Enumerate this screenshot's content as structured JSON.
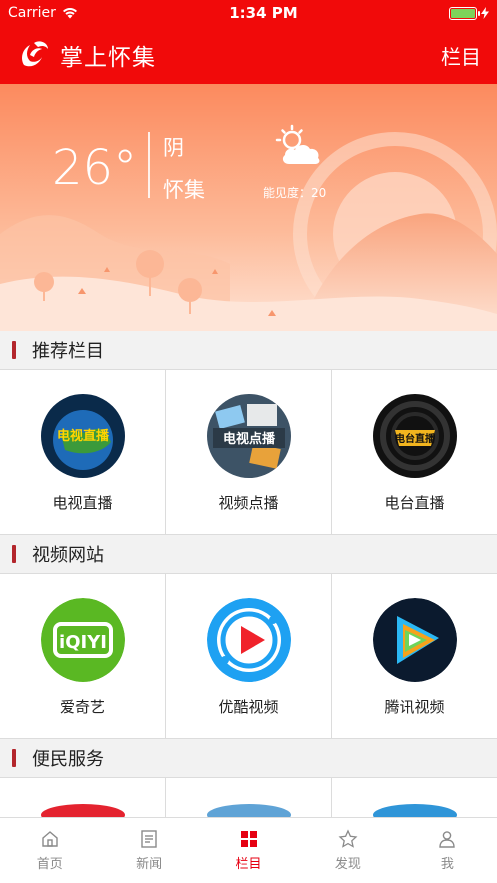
{
  "status": {
    "carrier": "Carrier",
    "time": "1:34 PM"
  },
  "header": {
    "title": "掌上怀集",
    "menu_label": "栏目"
  },
  "weather": {
    "temperature": "26°",
    "condition": "阴",
    "city": "怀集",
    "visibility": "能见度：20",
    "icon": "partly-cloudy-icon"
  },
  "sections": [
    {
      "title": "推荐栏目",
      "items": [
        {
          "label": "电视直播",
          "icon_text": "电视直播",
          "icon": "tv-live-icon"
        },
        {
          "label": "视频点播",
          "icon_text": "电视点播",
          "icon": "video-on-demand-icon"
        },
        {
          "label": "电台直播",
          "icon_text": "电台直播",
          "icon": "radio-live-icon"
        }
      ]
    },
    {
      "title": "视频网站",
      "items": [
        {
          "label": "爱奇艺",
          "icon_text": "iQIYI",
          "icon": "iqiyi-icon"
        },
        {
          "label": "优酷视频",
          "icon": "youku-icon"
        },
        {
          "label": "腾讯视频",
          "icon": "tencent-video-icon"
        }
      ]
    },
    {
      "title": "便民服务",
      "items": [
        {
          "label": "",
          "icon": "service-icon-1"
        },
        {
          "label": "",
          "icon": "service-icon-2"
        },
        {
          "label": "",
          "icon": "service-icon-3"
        }
      ]
    }
  ],
  "tabbar": [
    {
      "label": "首页",
      "icon": "home-icon"
    },
    {
      "label": "新闻",
      "icon": "news-icon"
    },
    {
      "label": "栏目",
      "icon": "grid-icon",
      "active": true
    },
    {
      "label": "发现",
      "icon": "discover-icon"
    },
    {
      "label": "我",
      "icon": "profile-icon"
    }
  ],
  "colors": {
    "brand": "#f10a0a",
    "active_tab": "#e60012",
    "section_bar": "#b3262c"
  }
}
